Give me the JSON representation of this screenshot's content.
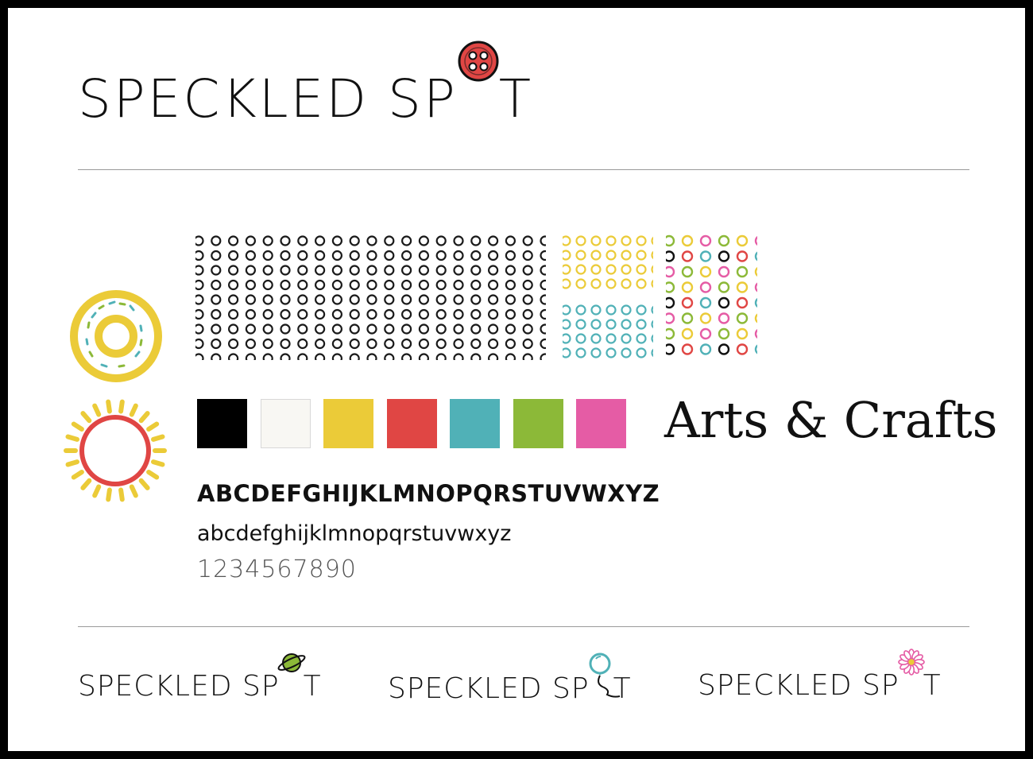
{
  "brand": {
    "word1": "SPECKLED",
    "word2_prefix": "SP",
    "word2_suffix": "T"
  },
  "colors": {
    "black": "#000000",
    "white": "#f8f7f3",
    "yellow": "#ebcb38",
    "red": "#e04644",
    "teal": "#50b1b7",
    "green": "#8cb938",
    "pink": "#e55ca5"
  },
  "palette": [
    {
      "name": "black",
      "hex": "#000000"
    },
    {
      "name": "white",
      "hex": "#f8f7f3"
    },
    {
      "name": "yellow",
      "hex": "#ebcb38"
    },
    {
      "name": "red",
      "hex": "#e04644"
    },
    {
      "name": "teal",
      "hex": "#50b1b7"
    },
    {
      "name": "green",
      "hex": "#8cb938"
    },
    {
      "name": "pink",
      "hex": "#e55ca5"
    }
  ],
  "typography": {
    "uppercase": "ABCDEFGHIJKLMNOPQRSTUVWXYZ",
    "lowercase": "abcdefghijklmnopqrstuvwxyz",
    "numbers": "1234567890",
    "display_sample": "Arts & Crafts"
  },
  "logo_variants": [
    {
      "icon": "button-icon"
    },
    {
      "icon": "planet-icon"
    },
    {
      "icon": "balloon-icon"
    },
    {
      "icon": "flower-icon"
    }
  ],
  "emblems": [
    {
      "icon": "donut-icon"
    },
    {
      "icon": "sun-icon"
    }
  ]
}
